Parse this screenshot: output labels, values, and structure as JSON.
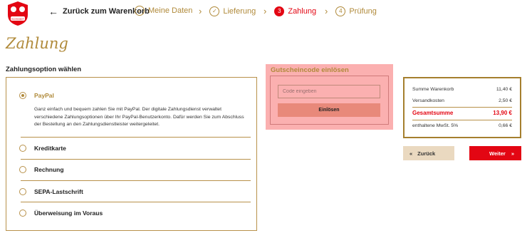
{
  "header": {
    "logo_text": "SCHMIDT",
    "back_label": "Zurück zum Warenkorb",
    "steps": [
      {
        "number": "✓",
        "label": "Meine Daten",
        "state": "done"
      },
      {
        "number": "✓",
        "label": "Lieferung",
        "state": "done"
      },
      {
        "number": "3",
        "label": "Zahlung",
        "state": "active"
      },
      {
        "number": "4",
        "label": "Prüfung",
        "state": "todo"
      }
    ]
  },
  "page_title": "Zahlung",
  "payment": {
    "section_title": "Zahlungsoption wählen",
    "options": [
      {
        "label": "PayPal",
        "selected": true,
        "description": "Ganz einfach und bequem zahlen Sie mit PayPal. Der digitale Zahlungsdienst verwaltet verschiedene Zahlungsoptionen über Ihr PayPal-Benutzerkonto. Dafür werden Sie zum Abschluss der Bestellung an den Zahlungsdienstleister weitergeleitet."
      },
      {
        "label": "Kreditkarte",
        "selected": false
      },
      {
        "label": "Rechnung",
        "selected": false
      },
      {
        "label": "SEPA-Lastschrift",
        "selected": false
      },
      {
        "label": "Überweisung im Voraus",
        "selected": false
      }
    ]
  },
  "coupon": {
    "title": "Gutscheincode einlösen",
    "placeholder": "Code eingeben",
    "button_label": "Einlösen"
  },
  "summary": {
    "rows": [
      {
        "label": "Summe Warenkorb",
        "value": "11,40 €"
      },
      {
        "label": "Versandkosten",
        "value": "2,50 €"
      }
    ],
    "total": {
      "label": "Gesamtsumme",
      "value": "13,90 €"
    },
    "vat": {
      "label": "enthaltene MwSt. 5%",
      "value": "0,66 €"
    }
  },
  "nav": {
    "back_label": "Zurück",
    "back_chevron": "«",
    "next_label": "Weiter",
    "next_chevron": "»"
  },
  "colors": {
    "accent_gold": "#b08a3a",
    "brand_red": "#e30613",
    "coupon_bg": "#fbb0b0"
  }
}
